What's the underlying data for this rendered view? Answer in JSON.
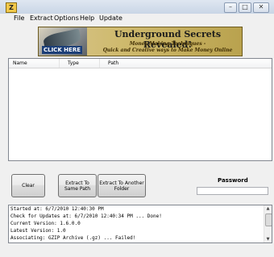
{
  "window": {
    "icon_letter": "Z",
    "minimize": "–",
    "maximize": "□",
    "close": "✕"
  },
  "menu": [
    "File",
    "Extract",
    "Options",
    "Help",
    "Update"
  ],
  "banner": {
    "title": "Underground Secrets Revealed!",
    "subtitle_line1": "Money Making Techniques -",
    "subtitle_line2": "Quick and Creative ways to Make Money Online",
    "cta": "CLICK HERE"
  },
  "list": {
    "columns": [
      "Name",
      "Type",
      "Path"
    ]
  },
  "buttons": {
    "clear": "Clear",
    "extract_same": "Extract To Same Path",
    "extract_another": "Extract To Another Folder"
  },
  "password": {
    "label": "Password",
    "value": ""
  },
  "log": [
    "Started at: 6/7/2010 12:40:30 PM",
    "Check for Updates at: 6/7/2010 12:40:34 PM ... Done!",
    "Current Version: 1.6.0.0",
    "Latest Version: 1.0",
    "Associating: GZIP Archive (.gz) ... Failed!"
  ],
  "scroll": {
    "up": "▲",
    "down": "▼"
  }
}
